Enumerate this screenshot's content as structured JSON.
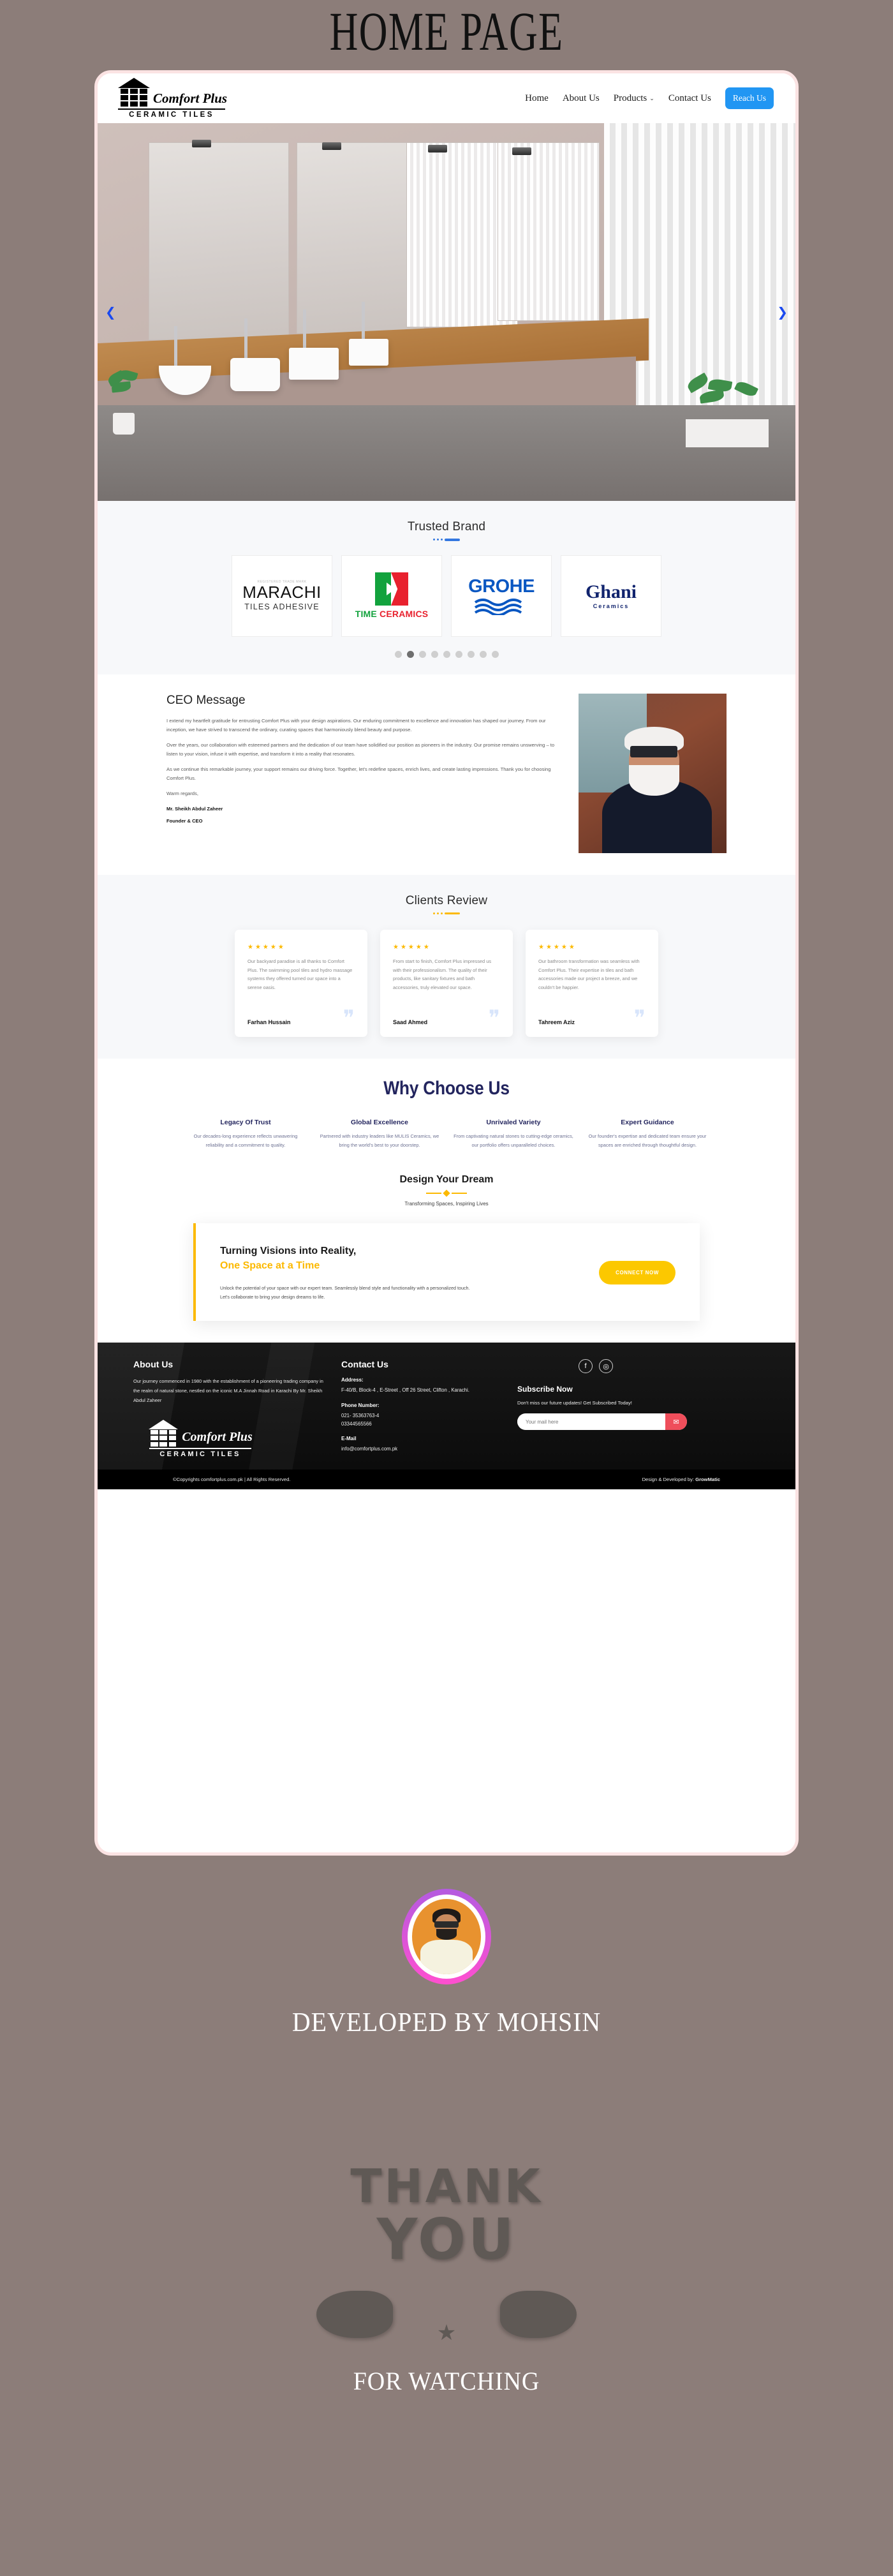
{
  "slide_title": "HOME PAGE",
  "nav": {
    "logo": {
      "word": "Comfort Plus",
      "sub": "CERAMIC TILES"
    },
    "links": [
      {
        "label": "Home"
      },
      {
        "label": "About Us"
      },
      {
        "label": "Products",
        "caret": "⌄"
      },
      {
        "label": "Contact Us"
      }
    ],
    "cta": "Reach Us"
  },
  "hero": {
    "prev": "❮",
    "next": "❯"
  },
  "brands": {
    "heading": "Trusted Brand",
    "items": [
      {
        "name": "MARACHI",
        "sub": "TILES ADHESIVE",
        "top": "REGISTERED TRADE MARK",
        "mark": "∞"
      },
      {
        "name": "TIME",
        "name2": "CERAMICS"
      },
      {
        "name": "GROHE"
      },
      {
        "name": "Ghani",
        "sub": "Ceramics"
      }
    ],
    "dots": 9,
    "active_dot": 2
  },
  "ceo": {
    "heading": "CEO Message",
    "paragraphs": [
      "I extend my heartfelt gratitude for entrusting Comfort Plus with your design aspirations. Our enduring commitment to excellence and innovation has shaped our journey. From our inception, we have strived to transcend the ordinary, curating spaces that harmoniously blend beauty and purpose.",
      "Over the years, our collaboration with esteemed partners and the dedication of our team have solidified our position as pioneers in the industry. Our promise remains unswerving – to listen to your vision, infuse it with expertise, and transform it into a reality that resonates.",
      "As we continue this remarkable journey, your support remains our driving force. Together, let's redefine spaces, enrich lives, and create lasting impressions. Thank you for choosing Comfort Plus.",
      "Warm regards,"
    ],
    "name": "Mr. Sheikh Abdul Zaheer",
    "role": "Founder & CEO"
  },
  "reviews": {
    "heading": "Clients Review",
    "items": [
      {
        "stars": "★★★★★",
        "text": "Our backyard paradise is all thanks to Comfort Plus. The swimming pool tiles and hydro massage systems they offered turned our space into a serene oasis.",
        "name": "Farhan Hussain",
        "quote": "❞"
      },
      {
        "stars": "★★★★★",
        "text": "From start to finish, Comfort Plus impressed us with their professionalism. The quality of their products, like sanitary fixtures and bath accessories, truly elevated our space.",
        "name": "Saad Ahmed",
        "quote": "❞"
      },
      {
        "stars": "★★★★★",
        "text": "Our bathroom transformation was seamless with Comfort Plus. Their expertise in tiles and bath accessories made our project a breeze, and we couldn't be happier.",
        "name": "Tahreem Aziz",
        "quote": "❞"
      }
    ]
  },
  "why": {
    "heading": "Why Choose Us",
    "columns": [
      {
        "title": "Legacy Of Trust",
        "text": "Our decades-long experience reflects unwavering reliability and a commitment to quality."
      },
      {
        "title": "Global Excellence",
        "text": "Partnered with industry leaders like MULIS Ceramics, we bring the world's best to your doorstep."
      },
      {
        "title": "Unrivaled Variety",
        "text": "From captivating natural stones to cutting-edge ceramics, our portfolio offers unparalleled choices."
      },
      {
        "title": "Expert Guidance",
        "text": "Our founder's expertise and dedicated team ensure your spaces are enriched through thoughtful design."
      }
    ]
  },
  "dream": {
    "heading": "Design Your Dream",
    "subheading": "Transforming Spaces, Inspiring Lives",
    "cta_line1": "Turning Visions into Reality,",
    "cta_line2": "One Space at a Time",
    "cta_text": "Unlock the potential of your space with our expert team. Seamlessly blend style and functionality with a personalized touch. Let's collaborate to bring your design dreams to life.",
    "cta_button": "CONNECT NOW"
  },
  "footer": {
    "about": {
      "heading": "About Us",
      "text": "Our journey commenced in 1980 with the establishment of a pioneering trading company in the realm of natural stone, nestled on the iconic M.A Jinnah Road in Karachi By Mr. Sheikh Abdul Zaheer",
      "logo_word": "Comfort Plus",
      "logo_sub": "CERAMIC TILES"
    },
    "contact": {
      "heading": "Contact Us",
      "address_label": "Address:",
      "address": "F-40/B, Block-4 , E-Street , Off 26 Street, Clifton , Karachi.",
      "phone_label": "Phone Number:",
      "phone1": "021- 35363763-4",
      "phone2": "03344565566",
      "email_label": "E-Mail",
      "email": "info@comfortplus.com.pk"
    },
    "social": [
      {
        "name": "facebook",
        "glyph": "f"
      },
      {
        "name": "instagram",
        "glyph": "◎"
      }
    ],
    "subscribe": {
      "heading": "Subscribe Now",
      "text": "Don't miss our future updates! Get Subscribed Today!",
      "placeholder": "Your mail here",
      "button_icon": "✉"
    },
    "copyright": "©Copyrights comfortplus.com.pk | All Rights Reserved.",
    "credit_prefix": "Design & Developed by: ",
    "credit_name": "GrowMatic"
  },
  "developer": {
    "caption": "DEVELOPED BY MOHSIN"
  },
  "thanks": {
    "line1": "THANK",
    "line2": "YOU",
    "caption": "FOR WATCHING"
  },
  "colors": {
    "accent_blue": "#2196f3",
    "accent_yellow": "#fcb900",
    "brand_navy": "#23255e",
    "page_bg": "#8c7d79"
  }
}
